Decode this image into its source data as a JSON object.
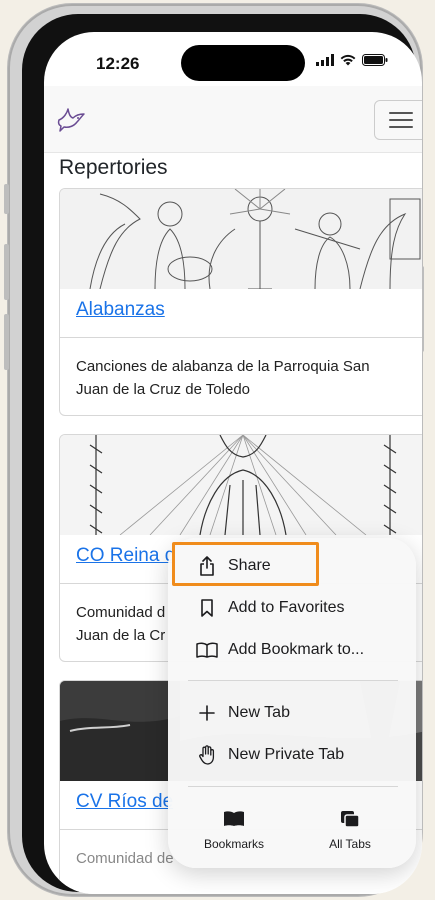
{
  "status": {
    "time": "12:26"
  },
  "page": {
    "title": "Repertories"
  },
  "cards": [
    {
      "title": "Alabanzas",
      "description": "Canciones de alabanza de la Parroquia San Juan de la Cruz de Toledo"
    },
    {
      "title": "CO Reina d",
      "description_line1": "Comunidad d",
      "description_line2": "Juan de la Cr"
    },
    {
      "title": "CV Ríos de",
      "description_line1": "Comunidad de"
    }
  ],
  "popup": {
    "items": [
      {
        "label": "Share",
        "icon": "share-icon"
      },
      {
        "label": "Add to Favorites",
        "icon": "bookmark-icon"
      },
      {
        "label": "Add Bookmark to...",
        "icon": "book-icon"
      },
      {
        "label": "New Tab",
        "icon": "plus-icon"
      },
      {
        "label": "New Private Tab",
        "icon": "hand-icon"
      }
    ],
    "bottom": [
      {
        "label": "Bookmarks",
        "icon": "bookmarks-icon"
      },
      {
        "label": "All Tabs",
        "icon": "tabs-icon"
      }
    ]
  },
  "colors": {
    "highlight": "#f08c1c",
    "link": "#1a73e8"
  }
}
